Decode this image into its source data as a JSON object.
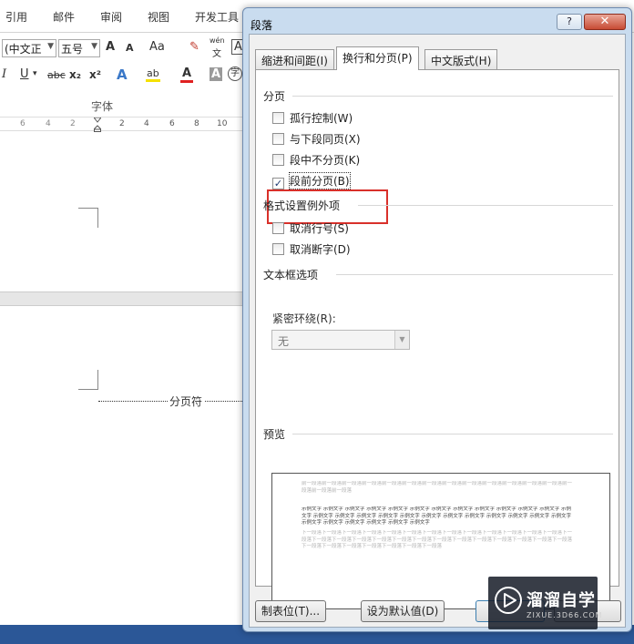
{
  "ribbon": {
    "tabs": [
      "引用",
      "邮件",
      "审阅",
      "视图",
      "开发工具"
    ],
    "font_name": "(中文正",
    "font_size": "五号",
    "group_label": "字体",
    "tools": {
      "grow": "A",
      "shrink": "A",
      "change_case": "Aa",
      "phonetic_top": "wén",
      "phonetic_bottom": "文",
      "italic": "I",
      "underline": "U",
      "strike": "abc",
      "subscript": "x₂",
      "superscript": "x²",
      "text_effects": "A",
      "highlight": "ab",
      "font_color": "A",
      "char_shading": "A",
      "enclosed": "字"
    }
  },
  "ruler": {
    "numbers": [
      "6",
      "4",
      "2",
      "2",
      "4",
      "6",
      "8",
      "10"
    ]
  },
  "document": {
    "page_break_label": "分页符"
  },
  "dialog": {
    "title": "段落",
    "help_label": "?",
    "close_label": "✕",
    "tabs": [
      {
        "label": "缩进和间距(I)",
        "active": false
      },
      {
        "label": "换行和分页(P)",
        "active": true
      },
      {
        "label": "中文版式(H)",
        "active": false
      }
    ],
    "pagination": {
      "heading": "分页",
      "items": [
        {
          "label": "孤行控制(W)",
          "checked": false
        },
        {
          "label": "与下段同页(X)",
          "checked": false
        },
        {
          "label": "段中不分页(K)",
          "checked": false
        },
        {
          "label": "段前分页(B)",
          "checked": true
        }
      ]
    },
    "exceptions": {
      "heading": "格式设置例外项",
      "items": [
        {
          "label": "取消行号(S)",
          "checked": false
        },
        {
          "label": "取消断字(D)",
          "checked": false
        }
      ]
    },
    "textbox": {
      "heading": "文本框选项",
      "wrap_label": "紧密环绕(R):",
      "wrap_value": "无"
    },
    "preview": {
      "heading": "预览",
      "prev_text": "前一段落前一段落前一段落前一段落前一段落前一段落前一段落前一段落前一段落前一段落前一段落前一段落前一段落前一段落前一段落前一段落",
      "sample_text": "示例文字 示例文字 示例文字 示例文字 示例文字 示例文字 示例文字 示例文字 示例文字 示例文字 示例文字 示例文字 示例文字 示例文字 示例文字 示例文字 示例文字 示例文字 示例文字 示例文字 示例文字 示例文字 示例文字 示例文字 示例文字 示例文字 示例文字 示例文字 示例文字 示例文字 示例文字",
      "next_text": "下一段落下一段落下一段落下一段落下一段落下一段落下一段落下一段落下一段落下一段落下一段落下一段落下一段落下一段落下一段落下一段落下一段落下一段落下一段落下一段落下一段落下一段落下一段落下一段落下一段落下一段落下一段落下一段落下一段落下一段落下一段落下一段落下一段落下一段落"
    },
    "buttons": {
      "tabs": "制表位(T)...",
      "set_default": "设为默认值(D)"
    }
  },
  "watermark": {
    "title": "溜溜自学",
    "subtitle": "ZIXUE.3D66.COM"
  },
  "colors": {
    "highlight_box": "#d9302a",
    "taskbar": "#2b5797",
    "dialog_frame": "#c9dcef"
  }
}
